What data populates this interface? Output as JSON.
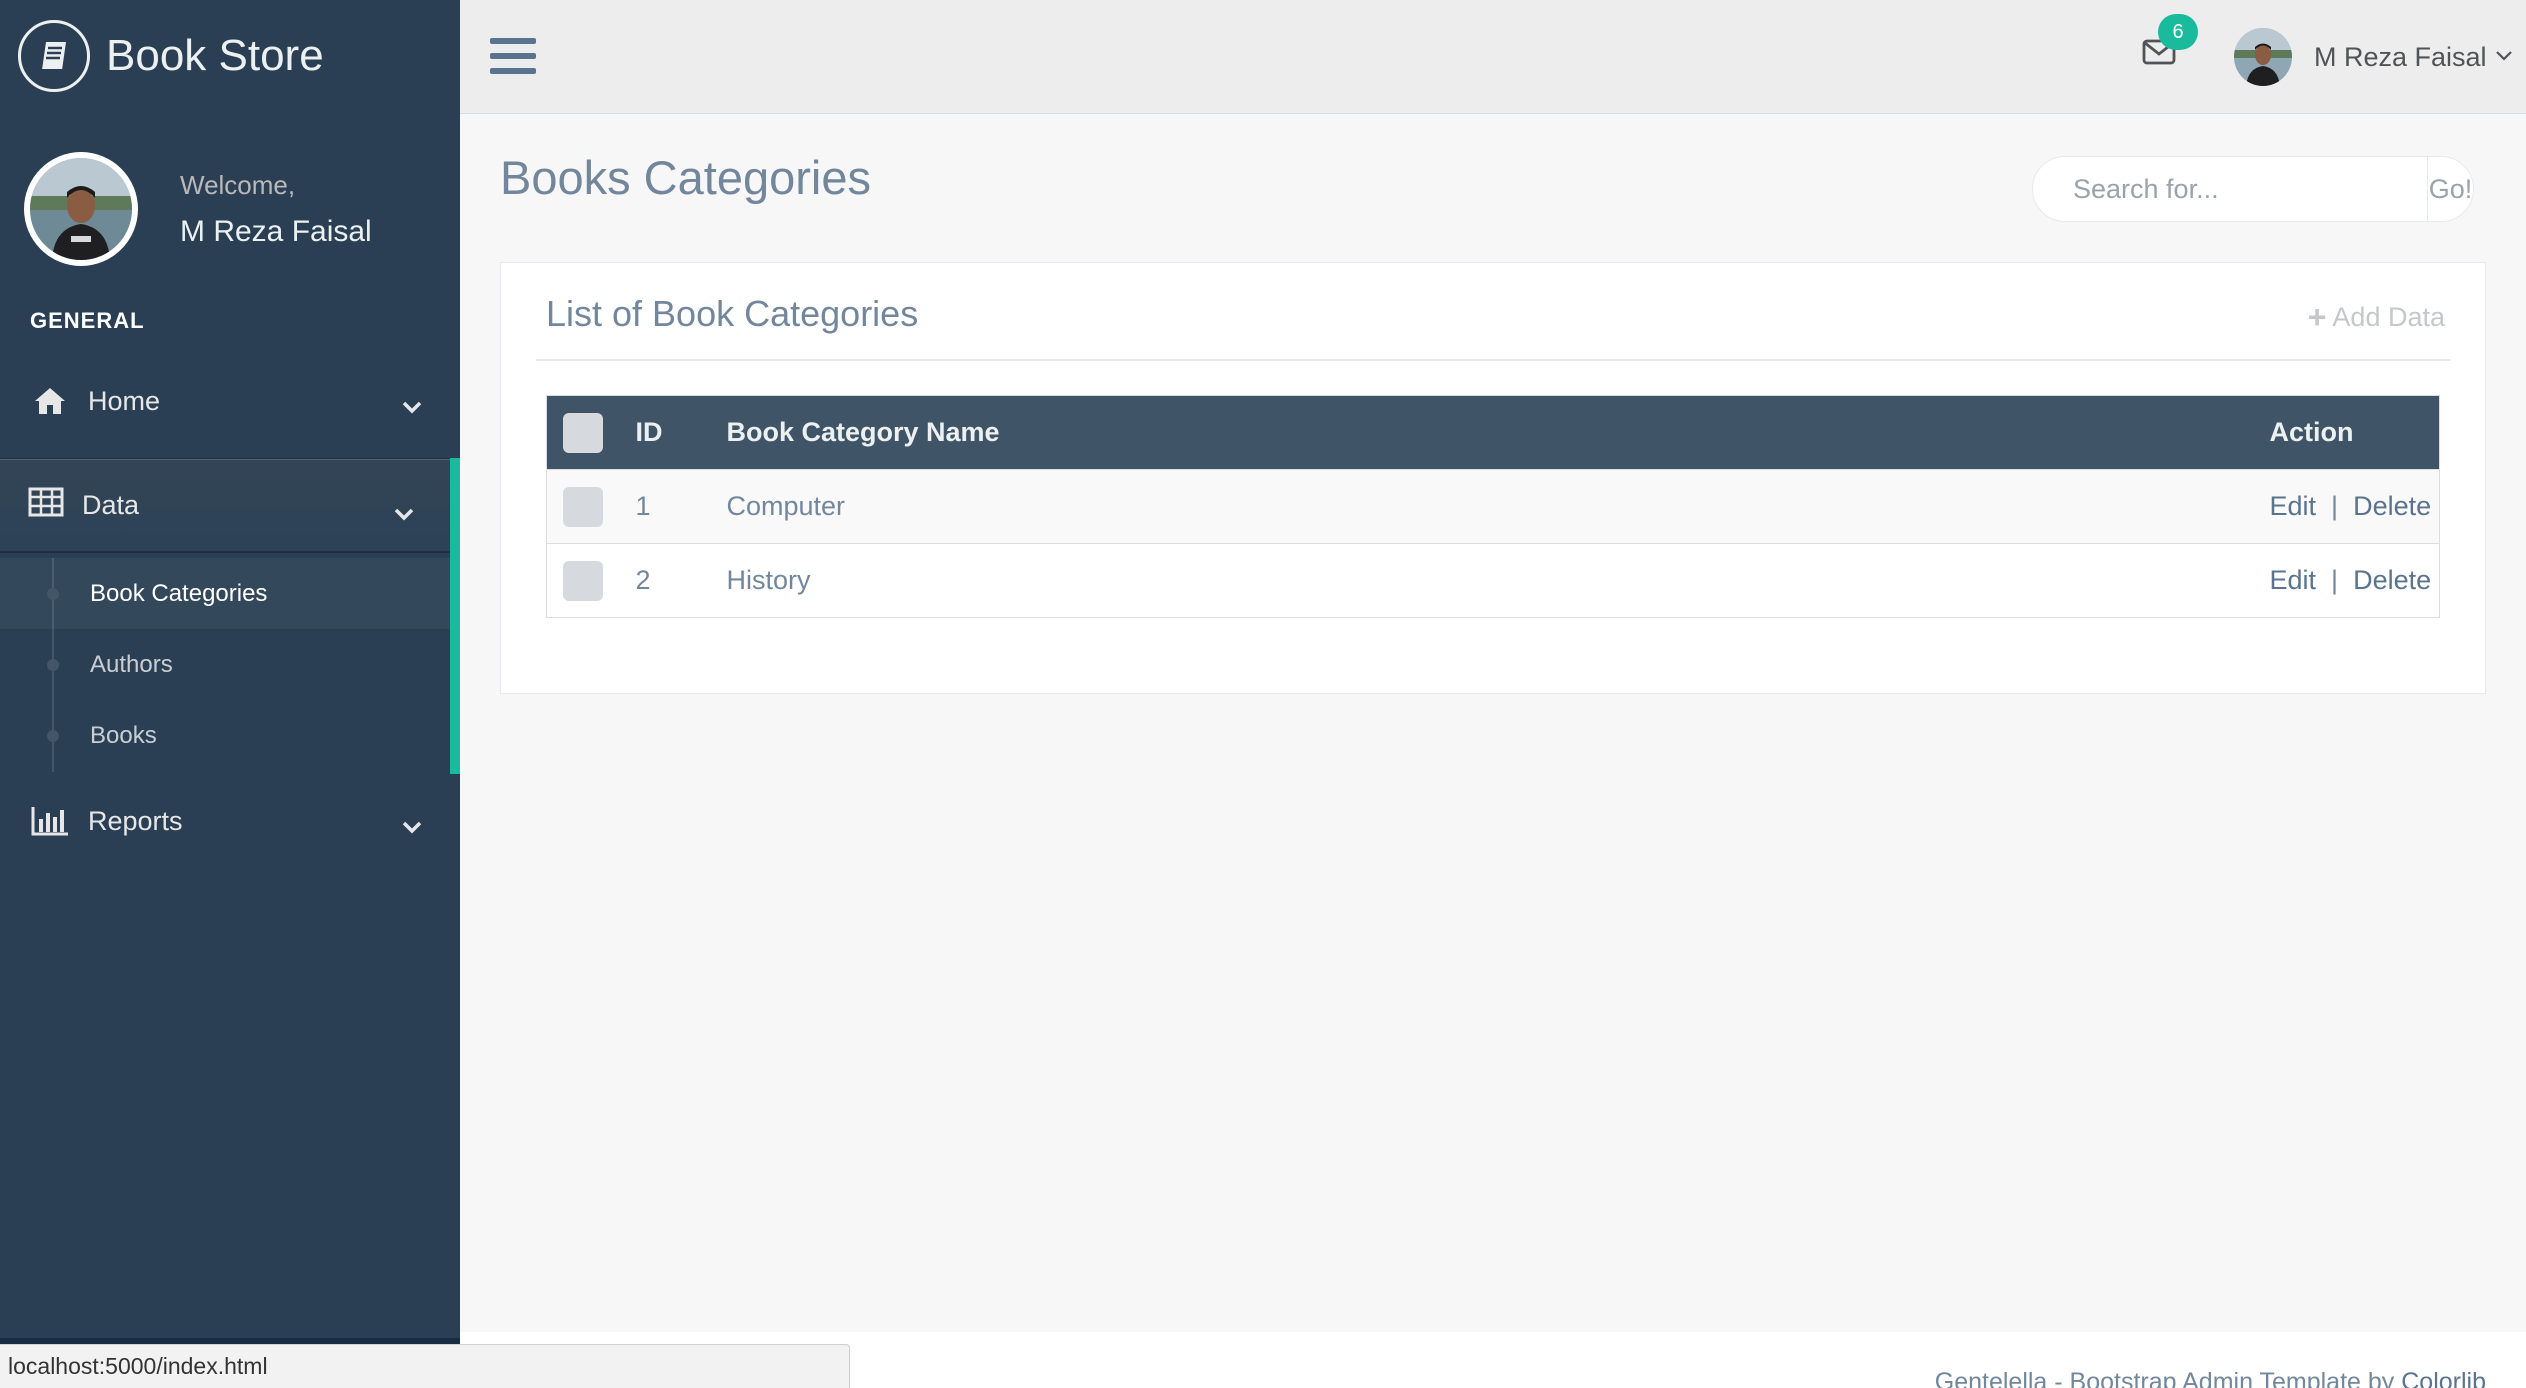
{
  "brand": {
    "title": "Book Store",
    "icon": "book-icon"
  },
  "profile": {
    "welcome": "Welcome,",
    "name": "M Reza Faisal"
  },
  "sidebar": {
    "section_title": "GENERAL",
    "items": [
      {
        "label": "Home",
        "icon": "home-icon"
      },
      {
        "label": "Data",
        "icon": "table-icon",
        "children": [
          "Book Categories",
          "Authors",
          "Books"
        ]
      },
      {
        "label": "Reports",
        "icon": "bar-chart-icon"
      }
    ]
  },
  "topnav": {
    "mail_count": "6",
    "user_name": "M Reza Faisal"
  },
  "page": {
    "title": "Books Categories",
    "search": {
      "placeholder": "Search for...",
      "button": "Go!"
    }
  },
  "panel": {
    "title": "List of Book Categories",
    "add_label": "Add Data",
    "table": {
      "headers": [
        "ID",
        "Book Category Name",
        "Action"
      ],
      "rows": [
        {
          "id": "1",
          "name": "Computer",
          "edit": "Edit",
          "sep": "|",
          "delete": "Delete"
        },
        {
          "id": "2",
          "name": "History",
          "edit": "Edit",
          "sep": "|",
          "delete": "Delete"
        }
      ]
    }
  },
  "footer": {
    "text": "Gentelella - Bootstrap Admin Template by ",
    "link": "Colorlib"
  },
  "status_bar": {
    "url": "localhost:5000/index.html"
  },
  "colors": {
    "sidebar": "#2A3F54",
    "accent": "#1ABB9C",
    "table_header": "#405467"
  }
}
